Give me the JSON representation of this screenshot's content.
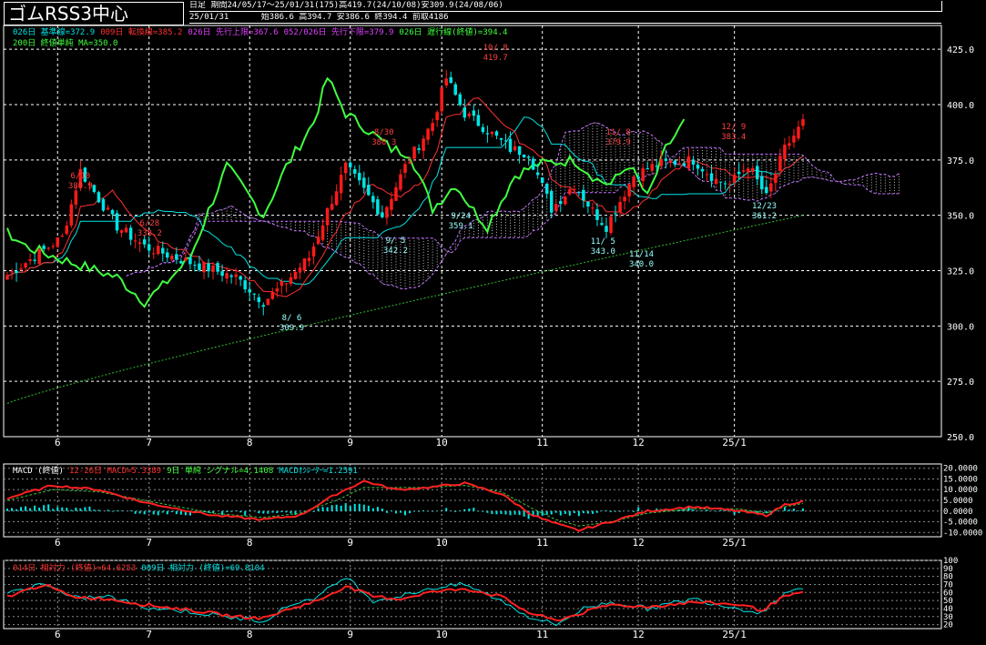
{
  "header": {
    "title": "ゴムRSS3中心",
    "period_label": "日足",
    "period_info": "期間24/05/17～25/01/31(175)高419.7(24/10/08)安309.9(24/08/06)",
    "date": "25/01/31",
    "ohlc": "始386.6 高394.7 安386.6 終394.4 前取4186"
  },
  "legends": {
    "main_1": [
      {
        "text": "026日 基準線=372.9",
        "color": "#00e5e5"
      },
      {
        "text": "009日 転換線=385.2",
        "color": "#ff3030"
      },
      {
        "text": "026日 先行上限=367.6",
        "color": "#e040ff"
      },
      {
        "text": "052/026日 先行下限=379.9",
        "color": "#e040ff"
      },
      {
        "text": "026日 遅行線(終値)=394.4",
        "color": "#40ff40"
      }
    ],
    "main_2": [
      {
        "text": "200日 終値単純 MA=350.0",
        "color": "#40ff40"
      }
    ],
    "macd": [
      {
        "text": "MACD (終値)",
        "color": "#ffffff"
      },
      {
        "text": "12-26日 MACD=5.3389",
        "color": "#ff3030"
      },
      {
        "text": "9日 単純 シグナル=4.1408",
        "color": "#40ff40"
      },
      {
        "text": "MACDｵｼﾚｰﾀｰ=1.2591",
        "color": "#00e5e5"
      }
    ],
    "rsi": [
      {
        "text": "014日 相対力 (終値)=64.6253",
        "color": "#ff3030"
      },
      {
        "text": "009日 相対力 (終値)=69.8104",
        "color": "#00e5e5"
      }
    ]
  },
  "colors": {
    "up": "#ff1a1a",
    "down": "#00e5e5",
    "kijun": "#00e5e5",
    "tenkan": "#ff3030",
    "chikou": "#40ff40",
    "ma": "#30c030",
    "cloud": "#c070ff",
    "grid": "#ffffff"
  },
  "chart_data": [
    {
      "type": "candlestick",
      "title": "ゴムRSS3中心",
      "ylim": [
        250,
        430
      ],
      "y_ticks": [
        "425.0",
        "400.0",
        "375.0",
        "350.0",
        "325.0",
        "300.0",
        "275.0",
        "250.0"
      ],
      "x_ticks": [
        "6",
        "7",
        "8",
        "9",
        "10",
        "11",
        "12",
        "25/1"
      ],
      "annotations": [
        {
          "label": "6/10",
          "value": "380.9"
        },
        {
          "label": "6/28",
          "value": "338.2"
        },
        {
          "label": "8/ 6",
          "value": "309.9"
        },
        {
          "label": "8/30",
          "value": "380.3"
        },
        {
          "label": "9/ 5",
          "value": "342.2"
        },
        {
          "label": "9/24",
          "value": "359.1"
        },
        {
          "label": "10/ 8",
          "value": "419.7"
        },
        {
          "label": "11/ 5",
          "value": "343.0"
        },
        {
          "label": "11/ 8",
          "value": "379.9"
        },
        {
          "label": "11/14",
          "value": "340.0"
        },
        {
          "label": "12/ 9",
          "value": "383.4"
        },
        {
          "label": "12/23",
          "value": "361.2"
        }
      ],
      "close_keypoints": [
        [
          0,
          323
        ],
        [
          12,
          340
        ],
        [
          16,
          370
        ],
        [
          24,
          345
        ],
        [
          30,
          336
        ],
        [
          38,
          330
        ],
        [
          50,
          322
        ],
        [
          56,
          311
        ],
        [
          60,
          318
        ],
        [
          66,
          331
        ],
        [
          70,
          352
        ],
        [
          74,
          372
        ],
        [
          77,
          364
        ],
        [
          82,
          350
        ],
        [
          87,
          372
        ],
        [
          93,
          392
        ],
        [
          96,
          412
        ],
        [
          100,
          396
        ],
        [
          104,
          390
        ],
        [
          110,
          380
        ],
        [
          114,
          378
        ],
        [
          119,
          353
        ],
        [
          124,
          364
        ],
        [
          128,
          352
        ],
        [
          131,
          345
        ],
        [
          137,
          368
        ],
        [
          142,
          373
        ],
        [
          150,
          375
        ],
        [
          155,
          366
        ],
        [
          158,
          364
        ],
        [
          162,
          373
        ],
        [
          166,
          358
        ],
        [
          170,
          380
        ],
        [
          174,
          392
        ]
      ],
      "ma200_range": [
        265,
        350
      ],
      "series": [
        {
          "name": "026日 基準線"
        },
        {
          "name": "009日 転換線"
        },
        {
          "name": "026日 先行上限"
        },
        {
          "name": "052/026日 先行下限"
        },
        {
          "name": "026日 遅行線(終値)"
        },
        {
          "name": "200日 終値単純 MA"
        }
      ]
    },
    {
      "type": "line",
      "title": "MACD (終値)",
      "ylim": [
        -12,
        22
      ],
      "y_ticks": [
        "20.0000",
        "15.0000",
        "10.0000",
        "5.0000",
        "0.0000",
        "-5.0000",
        "-10.0000"
      ],
      "macd_keypoints": [
        [
          0,
          6
        ],
        [
          10,
          12
        ],
        [
          20,
          10
        ],
        [
          30,
          4
        ],
        [
          45,
          -2
        ],
        [
          56,
          -4
        ],
        [
          64,
          -2
        ],
        [
          72,
          8
        ],
        [
          78,
          14
        ],
        [
          85,
          10
        ],
        [
          92,
          11
        ],
        [
          100,
          13
        ],
        [
          108,
          8
        ],
        [
          115,
          -2
        ],
        [
          120,
          -6
        ],
        [
          125,
          -9
        ],
        [
          132,
          -5
        ],
        [
          140,
          0
        ],
        [
          150,
          2
        ],
        [
          160,
          0
        ],
        [
          166,
          -2
        ],
        [
          170,
          3
        ],
        [
          175,
          5
        ]
      ],
      "signal_keypoints": [
        [
          0,
          5
        ],
        [
          10,
          10
        ],
        [
          20,
          9
        ],
        [
          30,
          5
        ],
        [
          45,
          -1
        ],
        [
          56,
          -3
        ],
        [
          64,
          -1
        ],
        [
          72,
          5
        ],
        [
          78,
          11
        ],
        [
          85,
          11
        ],
        [
          92,
          11
        ],
        [
          100,
          12
        ],
        [
          108,
          9
        ],
        [
          115,
          1
        ],
        [
          120,
          -4
        ],
        [
          125,
          -7
        ],
        [
          132,
          -5
        ],
        [
          140,
          -1
        ],
        [
          150,
          1
        ],
        [
          160,
          1
        ],
        [
          166,
          -1
        ],
        [
          170,
          2
        ],
        [
          175,
          4
        ]
      ]
    },
    {
      "type": "line",
      "title": "相対力",
      "ylim": [
        15,
        100
      ],
      "y_ticks": [
        "100",
        "90",
        "80",
        "70",
        "60",
        "50",
        "40",
        "30",
        "20"
      ],
      "rsi14_keypoints": [
        [
          0,
          55
        ],
        [
          8,
          70
        ],
        [
          14,
          55
        ],
        [
          22,
          52
        ],
        [
          30,
          45
        ],
        [
          40,
          38
        ],
        [
          50,
          30
        ],
        [
          56,
          28
        ],
        [
          62,
          40
        ],
        [
          68,
          50
        ],
        [
          74,
          68
        ],
        [
          80,
          55
        ],
        [
          86,
          52
        ],
        [
          92,
          60
        ],
        [
          100,
          65
        ],
        [
          108,
          55
        ],
        [
          114,
          35
        ],
        [
          120,
          25
        ],
        [
          126,
          35
        ],
        [
          132,
          45
        ],
        [
          140,
          42
        ],
        [
          150,
          48
        ],
        [
          160,
          45
        ],
        [
          165,
          38
        ],
        [
          170,
          55
        ],
        [
          175,
          60
        ]
      ],
      "rsi9_keypoints": [
        [
          0,
          58
        ],
        [
          8,
          72
        ],
        [
          14,
          53
        ],
        [
          22,
          55
        ],
        [
          30,
          42
        ],
        [
          40,
          36
        ],
        [
          50,
          28
        ],
        [
          56,
          25
        ],
        [
          62,
          45
        ],
        [
          68,
          55
        ],
        [
          74,
          80
        ],
        [
          80,
          50
        ],
        [
          86,
          55
        ],
        [
          92,
          65
        ],
        [
          100,
          70
        ],
        [
          108,
          50
        ],
        [
          114,
          30
        ],
        [
          120,
          20
        ],
        [
          126,
          40
        ],
        [
          132,
          48
        ],
        [
          140,
          40
        ],
        [
          150,
          52
        ],
        [
          160,
          40
        ],
        [
          165,
          35
        ],
        [
          170,
          60
        ],
        [
          175,
          68
        ]
      ]
    }
  ]
}
